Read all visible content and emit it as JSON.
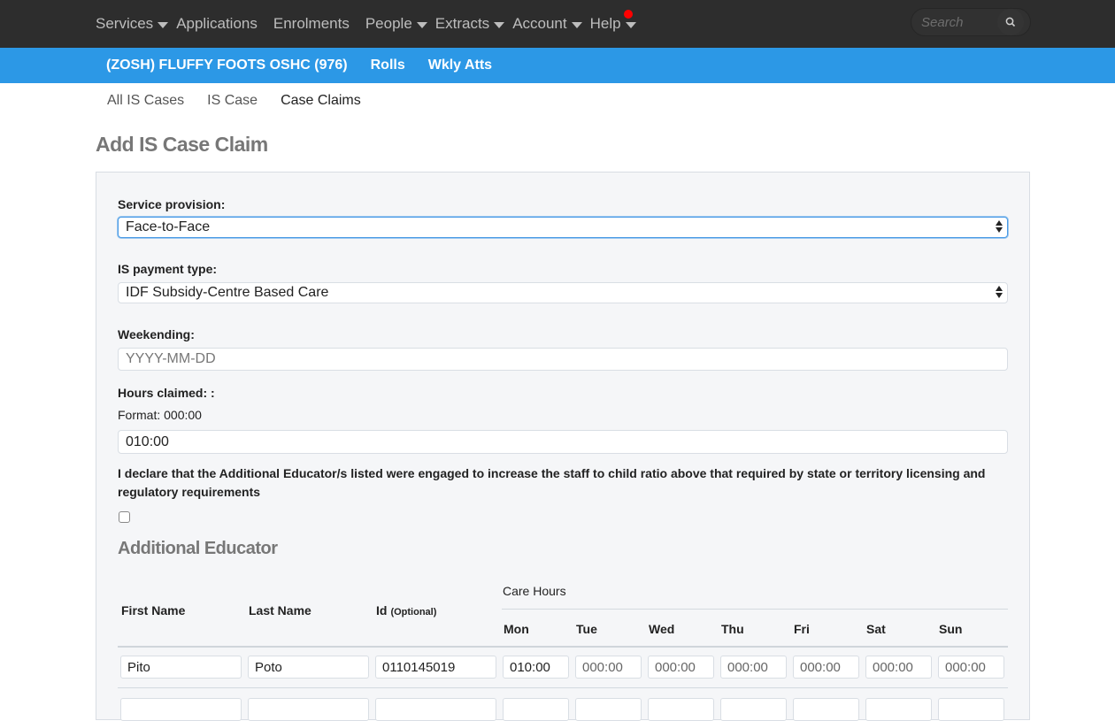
{
  "topnav": {
    "items": [
      {
        "label": "Services",
        "caret": true
      },
      {
        "label": "Applications",
        "caret": false
      },
      {
        "label": "Enrolments",
        "caret": false
      },
      {
        "label": "People",
        "caret": true
      },
      {
        "label": "Extracts",
        "caret": true
      },
      {
        "label": "Account",
        "caret": true
      },
      {
        "label": "Help",
        "caret": true,
        "notification": true
      }
    ],
    "search_placeholder": "Search"
  },
  "service_bar": {
    "items": [
      "(ZOSH) FLUFFY FOOTS OSHC (976)",
      "Rolls",
      "Wkly Atts"
    ]
  },
  "subnav": {
    "items": [
      "All IS Cases",
      "IS Case",
      "Case Claims"
    ],
    "active": "Case Claims"
  },
  "page_title": "Add IS Case Claim",
  "form": {
    "service_provision": {
      "label": "Service provision:",
      "value": "Face-to-Face"
    },
    "payment_type": {
      "label": "IS payment type:",
      "value": "IDF Subsidy-Centre Based Care"
    },
    "weekending": {
      "label": "Weekending:",
      "placeholder": "YYYY-MM-DD",
      "value": ""
    },
    "hours_claimed": {
      "label": "Hours claimed: :",
      "help": "Format: 000:00",
      "value": "010:00"
    },
    "declaration": {
      "text": "I declare that the Additional Educator/s listed were engaged to increase the staff to child ratio above that required by state or territory licensing and regulatory requirements",
      "checked": false
    }
  },
  "educators": {
    "title": "Additional Educator",
    "headers": {
      "first_name": "First Name",
      "last_name": "Last Name",
      "id": "Id",
      "id_note": "(Optional)",
      "care_hours": "Care Hours",
      "days": [
        "Mon",
        "Tue",
        "Wed",
        "Thu",
        "Fri",
        "Sat",
        "Sun"
      ]
    },
    "rows": [
      {
        "first_name": "Pito",
        "last_name": "Poto",
        "id": "0110145019",
        "hours": [
          "010:00",
          "",
          "",
          "",
          "",
          "",
          ""
        ]
      }
    ],
    "hours_placeholder": "000:00"
  }
}
